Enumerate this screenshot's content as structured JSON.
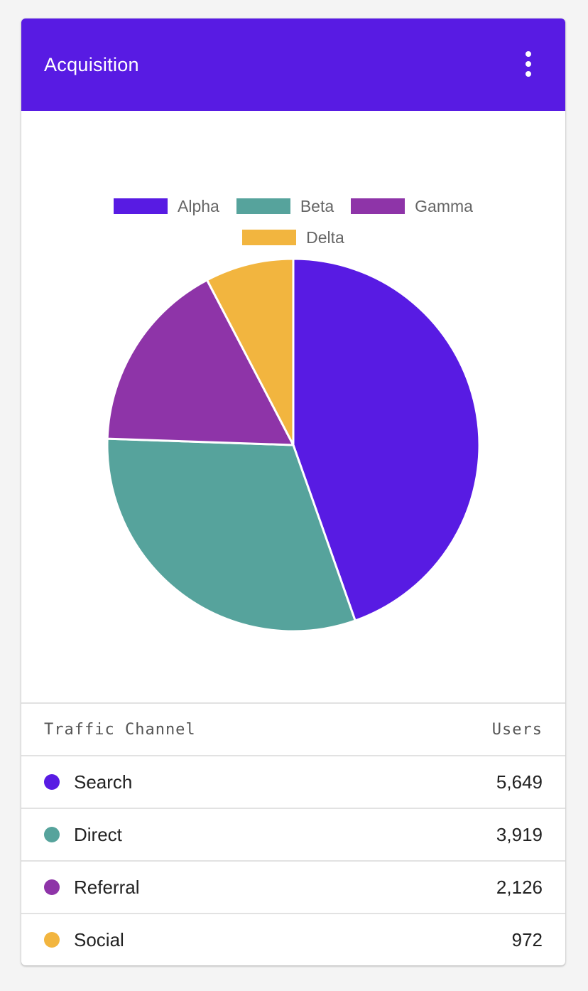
{
  "card": {
    "title": "Acquisition",
    "menu_icon": "more-vert-icon"
  },
  "chart_data": {
    "type": "pie",
    "categories": [
      "Alpha",
      "Beta",
      "Gamma",
      "Delta"
    ],
    "values": [
      5649,
      3919,
      2126,
      972
    ],
    "colors": [
      "#581be3",
      "#56a39c",
      "#8e34a8",
      "#f2b53f"
    ],
    "legend_position": "top",
    "title": ""
  },
  "table": {
    "headers": {
      "channel": "Traffic Channel",
      "users": "Users"
    },
    "rows": [
      {
        "channel": "Search",
        "users": "5,649",
        "color": "#581be3"
      },
      {
        "channel": "Direct",
        "users": "3,919",
        "color": "#56a39c"
      },
      {
        "channel": "Referral",
        "users": "2,126",
        "color": "#8e34a8"
      },
      {
        "channel": "Social",
        "users": "972",
        "color": "#f2b53f"
      }
    ]
  }
}
